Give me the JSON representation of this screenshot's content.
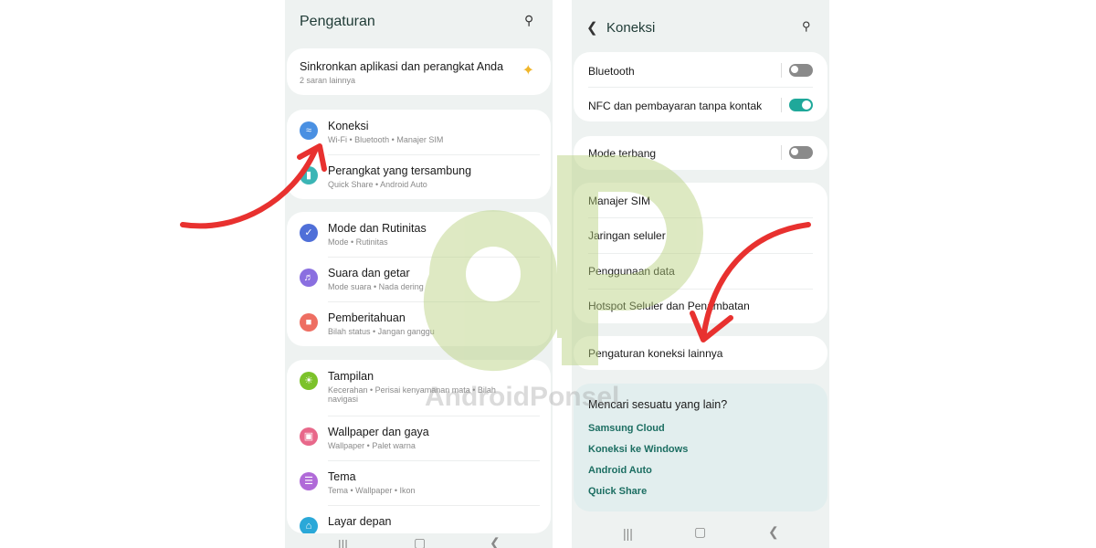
{
  "left": {
    "title": "Pengaturan",
    "suggestion": {
      "title": "Sinkronkan aplikasi dan perangkat Anda",
      "subtitle": "2 saran lainnya"
    },
    "groups": [
      [
        {
          "title": "Koneksi",
          "subtitle": "Wi-Fi • Bluetooth • Manajer SIM",
          "icon": "wifi-icon",
          "color": "#4a90e2"
        },
        {
          "title": "Perangkat yang tersambung",
          "subtitle": "Quick Share • Android Auto",
          "icon": "devices-icon",
          "color": "#3bb5b5"
        }
      ],
      [
        {
          "title": "Mode dan Rutinitas",
          "subtitle": "Mode • Rutinitas",
          "icon": "check-circle-icon",
          "color": "#4f6fd8"
        },
        {
          "title": "Suara dan getar",
          "subtitle": "Mode suara • Nada dering",
          "icon": "volume-icon",
          "color": "#8a6fe0"
        },
        {
          "title": "Pemberitahuan",
          "subtitle": "Bilah status • Jangan ganggu",
          "icon": "notification-icon",
          "color": "#ee6e62"
        }
      ],
      [
        {
          "title": "Tampilan",
          "subtitle": "Kecerahan • Perisai kenyamanan mata • Bilah navigasi",
          "icon": "brightness-icon",
          "color": "#7cc22a"
        },
        {
          "title": "Wallpaper dan gaya",
          "subtitle": "Wallpaper • Palet warna",
          "icon": "wallpaper-icon",
          "color": "#e8688a"
        },
        {
          "title": "Tema",
          "subtitle": "Tema • Wallpaper • Ikon",
          "icon": "theme-icon",
          "color": "#b06ad8"
        },
        {
          "title": "Layar depan",
          "subtitle": "",
          "icon": "home-icon",
          "color": "#2aa8d8"
        }
      ]
    ]
  },
  "right": {
    "title": "Koneksi",
    "toggles": [
      {
        "label": "Bluetooth",
        "on": false
      },
      {
        "label": "NFC dan pembayaran tanpa kontak",
        "on": true
      }
    ],
    "airplane": {
      "label": "Mode terbang",
      "on": false
    },
    "items": [
      "Manajer SIM",
      "Jaringan seluler",
      "Penggunaan data",
      "Hotspot Seluler dan Penambatan"
    ],
    "more": "Pengaturan koneksi lainnya",
    "suggest": {
      "title": "Mencari sesuatu yang lain?",
      "links": [
        "Samsung Cloud",
        "Koneksi ke Windows",
        "Android Auto",
        "Quick Share"
      ]
    }
  },
  "watermark": {
    "logo": "dP",
    "text": "AndroidPonsel"
  },
  "colors": {
    "accent": "#1fa89a",
    "arrow": "#e8312f",
    "watermark": "#b5cf7a"
  }
}
